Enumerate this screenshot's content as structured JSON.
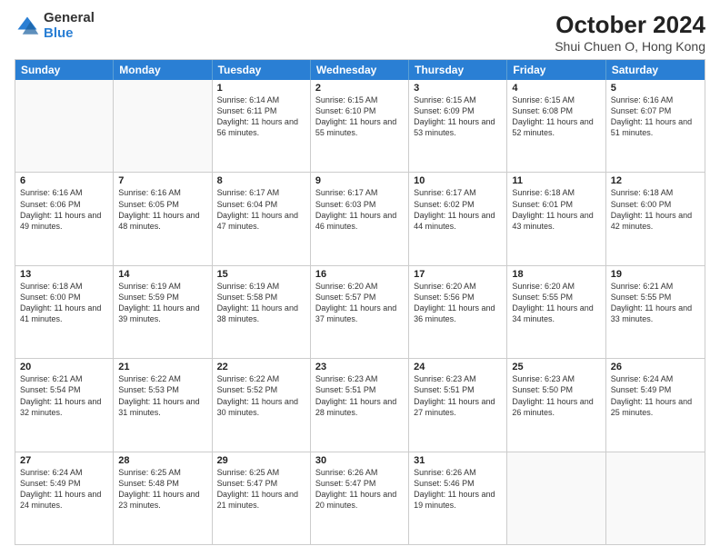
{
  "logo": {
    "general": "General",
    "blue": "Blue"
  },
  "title": "October 2024",
  "location": "Shui Chuen O, Hong Kong",
  "days_of_week": [
    "Sunday",
    "Monday",
    "Tuesday",
    "Wednesday",
    "Thursday",
    "Friday",
    "Saturday"
  ],
  "weeks": [
    [
      {
        "day": "",
        "info": ""
      },
      {
        "day": "",
        "info": ""
      },
      {
        "day": "1",
        "info": "Sunrise: 6:14 AM\nSunset: 6:11 PM\nDaylight: 11 hours and 56 minutes."
      },
      {
        "day": "2",
        "info": "Sunrise: 6:15 AM\nSunset: 6:10 PM\nDaylight: 11 hours and 55 minutes."
      },
      {
        "day": "3",
        "info": "Sunrise: 6:15 AM\nSunset: 6:09 PM\nDaylight: 11 hours and 53 minutes."
      },
      {
        "day": "4",
        "info": "Sunrise: 6:15 AM\nSunset: 6:08 PM\nDaylight: 11 hours and 52 minutes."
      },
      {
        "day": "5",
        "info": "Sunrise: 6:16 AM\nSunset: 6:07 PM\nDaylight: 11 hours and 51 minutes."
      }
    ],
    [
      {
        "day": "6",
        "info": "Sunrise: 6:16 AM\nSunset: 6:06 PM\nDaylight: 11 hours and 49 minutes."
      },
      {
        "day": "7",
        "info": "Sunrise: 6:16 AM\nSunset: 6:05 PM\nDaylight: 11 hours and 48 minutes."
      },
      {
        "day": "8",
        "info": "Sunrise: 6:17 AM\nSunset: 6:04 PM\nDaylight: 11 hours and 47 minutes."
      },
      {
        "day": "9",
        "info": "Sunrise: 6:17 AM\nSunset: 6:03 PM\nDaylight: 11 hours and 46 minutes."
      },
      {
        "day": "10",
        "info": "Sunrise: 6:17 AM\nSunset: 6:02 PM\nDaylight: 11 hours and 44 minutes."
      },
      {
        "day": "11",
        "info": "Sunrise: 6:18 AM\nSunset: 6:01 PM\nDaylight: 11 hours and 43 minutes."
      },
      {
        "day": "12",
        "info": "Sunrise: 6:18 AM\nSunset: 6:00 PM\nDaylight: 11 hours and 42 minutes."
      }
    ],
    [
      {
        "day": "13",
        "info": "Sunrise: 6:18 AM\nSunset: 6:00 PM\nDaylight: 11 hours and 41 minutes."
      },
      {
        "day": "14",
        "info": "Sunrise: 6:19 AM\nSunset: 5:59 PM\nDaylight: 11 hours and 39 minutes."
      },
      {
        "day": "15",
        "info": "Sunrise: 6:19 AM\nSunset: 5:58 PM\nDaylight: 11 hours and 38 minutes."
      },
      {
        "day": "16",
        "info": "Sunrise: 6:20 AM\nSunset: 5:57 PM\nDaylight: 11 hours and 37 minutes."
      },
      {
        "day": "17",
        "info": "Sunrise: 6:20 AM\nSunset: 5:56 PM\nDaylight: 11 hours and 36 minutes."
      },
      {
        "day": "18",
        "info": "Sunrise: 6:20 AM\nSunset: 5:55 PM\nDaylight: 11 hours and 34 minutes."
      },
      {
        "day": "19",
        "info": "Sunrise: 6:21 AM\nSunset: 5:55 PM\nDaylight: 11 hours and 33 minutes."
      }
    ],
    [
      {
        "day": "20",
        "info": "Sunrise: 6:21 AM\nSunset: 5:54 PM\nDaylight: 11 hours and 32 minutes."
      },
      {
        "day": "21",
        "info": "Sunrise: 6:22 AM\nSunset: 5:53 PM\nDaylight: 11 hours and 31 minutes."
      },
      {
        "day": "22",
        "info": "Sunrise: 6:22 AM\nSunset: 5:52 PM\nDaylight: 11 hours and 30 minutes."
      },
      {
        "day": "23",
        "info": "Sunrise: 6:23 AM\nSunset: 5:51 PM\nDaylight: 11 hours and 28 minutes."
      },
      {
        "day": "24",
        "info": "Sunrise: 6:23 AM\nSunset: 5:51 PM\nDaylight: 11 hours and 27 minutes."
      },
      {
        "day": "25",
        "info": "Sunrise: 6:23 AM\nSunset: 5:50 PM\nDaylight: 11 hours and 26 minutes."
      },
      {
        "day": "26",
        "info": "Sunrise: 6:24 AM\nSunset: 5:49 PM\nDaylight: 11 hours and 25 minutes."
      }
    ],
    [
      {
        "day": "27",
        "info": "Sunrise: 6:24 AM\nSunset: 5:49 PM\nDaylight: 11 hours and 24 minutes."
      },
      {
        "day": "28",
        "info": "Sunrise: 6:25 AM\nSunset: 5:48 PM\nDaylight: 11 hours and 23 minutes."
      },
      {
        "day": "29",
        "info": "Sunrise: 6:25 AM\nSunset: 5:47 PM\nDaylight: 11 hours and 21 minutes."
      },
      {
        "day": "30",
        "info": "Sunrise: 6:26 AM\nSunset: 5:47 PM\nDaylight: 11 hours and 20 minutes."
      },
      {
        "day": "31",
        "info": "Sunrise: 6:26 AM\nSunset: 5:46 PM\nDaylight: 11 hours and 19 minutes."
      },
      {
        "day": "",
        "info": ""
      },
      {
        "day": "",
        "info": ""
      }
    ]
  ]
}
